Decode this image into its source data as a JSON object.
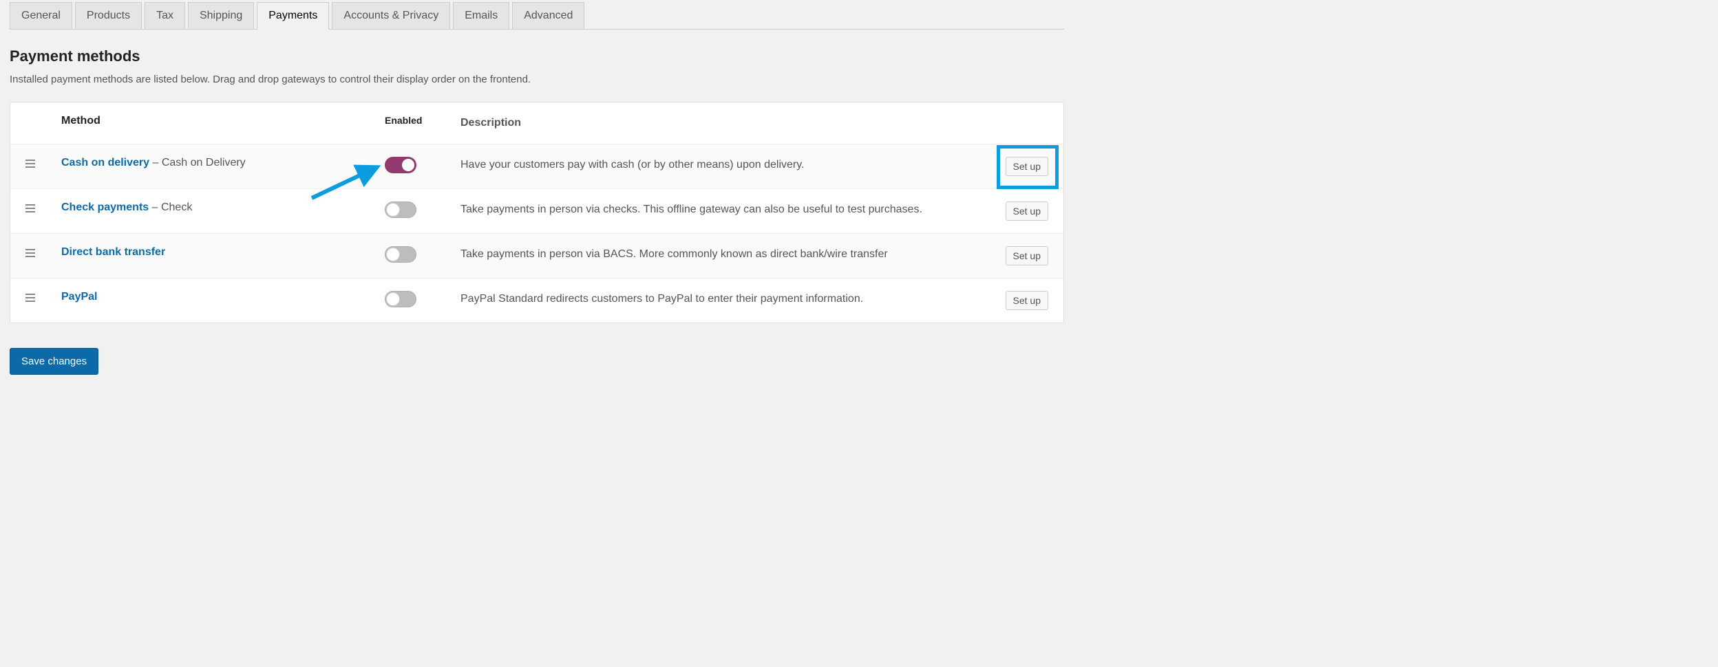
{
  "tabs": {
    "items": [
      {
        "label": "General",
        "active": false
      },
      {
        "label": "Products",
        "active": false
      },
      {
        "label": "Tax",
        "active": false
      },
      {
        "label": "Shipping",
        "active": false
      },
      {
        "label": "Payments",
        "active": true
      },
      {
        "label": "Accounts & Privacy",
        "active": false
      },
      {
        "label": "Emails",
        "active": false
      },
      {
        "label": "Advanced",
        "active": false
      }
    ]
  },
  "page": {
    "title": "Payment methods",
    "description": "Installed payment methods are listed below. Drag and drop gateways to control their display order on the frontend."
  },
  "columns": {
    "method": "Method",
    "enabled": "Enabled",
    "description": "Description"
  },
  "rows": [
    {
      "name": "Cash on delivery",
      "subname": "Cash on Delivery",
      "enabled": true,
      "description": "Have your customers pay with cash (or by other means) upon delivery.",
      "action": "Set up",
      "highlight": true
    },
    {
      "name": "Check payments",
      "subname": "Check",
      "enabled": false,
      "description": "Take payments in person via checks. This offline gateway can also be useful to test purchases.",
      "action": "Set up",
      "highlight": false
    },
    {
      "name": "Direct bank transfer",
      "subname": "",
      "enabled": false,
      "description": "Take payments in person via BACS. More commonly known as direct bank/wire transfer",
      "action": "Set up",
      "highlight": false
    },
    {
      "name": "PayPal",
      "subname": "",
      "enabled": false,
      "description": "PayPal Standard redirects customers to PayPal to enter their payment information.",
      "action": "Set up",
      "highlight": false
    }
  ],
  "save_label": "Save changes",
  "annotation": {
    "arrow_color": "#0b9ddd",
    "highlight_color": "#0b9ddd"
  }
}
